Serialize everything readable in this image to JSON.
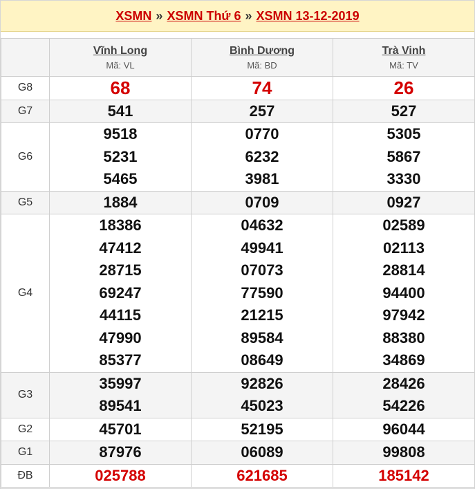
{
  "breadcrumb": {
    "items": [
      "XSMN",
      "XSMN Thứ 6",
      "XSMN 13-12-2019"
    ],
    "separator": "»"
  },
  "provinces": [
    {
      "name": "Vĩnh Long",
      "code": "Mã: VL"
    },
    {
      "name": "Bình Dương",
      "code": "Mã: BD"
    },
    {
      "name": "Trà Vinh",
      "code": "Mã: TV"
    }
  ],
  "prizes": [
    {
      "label": "G8",
      "values": [
        [
          "68"
        ],
        [
          "74"
        ],
        [
          "26"
        ]
      ]
    },
    {
      "label": "G7",
      "values": [
        [
          "541"
        ],
        [
          "257"
        ],
        [
          "527"
        ]
      ]
    },
    {
      "label": "G6",
      "values": [
        [
          "9518",
          "5231",
          "5465"
        ],
        [
          "0770",
          "6232",
          "3981"
        ],
        [
          "5305",
          "5867",
          "3330"
        ]
      ]
    },
    {
      "label": "G5",
      "values": [
        [
          "1884"
        ],
        [
          "0709"
        ],
        [
          "0927"
        ]
      ]
    },
    {
      "label": "G4",
      "values": [
        [
          "18386",
          "47412",
          "28715",
          "69247",
          "44115",
          "47990",
          "85377"
        ],
        [
          "04632",
          "49941",
          "07073",
          "77590",
          "21215",
          "89584",
          "08649"
        ],
        [
          "02589",
          "02113",
          "28814",
          "94400",
          "97942",
          "88380",
          "34869"
        ]
      ]
    },
    {
      "label": "G3",
      "values": [
        [
          "35997",
          "89541"
        ],
        [
          "92826",
          "45023"
        ],
        [
          "28426",
          "54226"
        ]
      ]
    },
    {
      "label": "G2",
      "values": [
        [
          "45701"
        ],
        [
          "52195"
        ],
        [
          "96044"
        ]
      ]
    },
    {
      "label": "G1",
      "values": [
        [
          "87976"
        ],
        [
          "06089"
        ],
        [
          "99808"
        ]
      ]
    },
    {
      "label": "ĐB",
      "values": [
        [
          "025788"
        ],
        [
          "621685"
        ],
        [
          "185142"
        ]
      ]
    }
  ],
  "colors": {
    "accent_red": "#d40000",
    "breadcrumb_bg": "#fff4c4",
    "row_shade": "#f4f4f4"
  }
}
